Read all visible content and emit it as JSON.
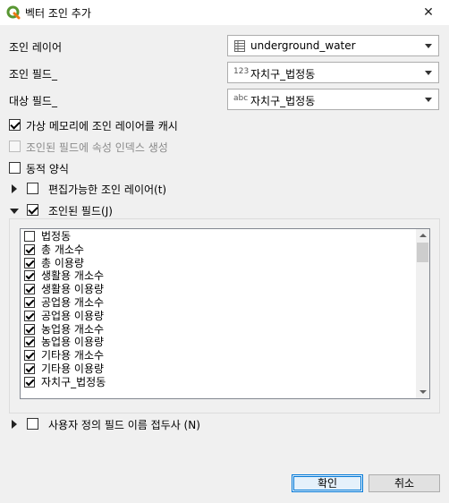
{
  "window": {
    "title": "벡터 조인 추가",
    "close_glyph": "✕"
  },
  "form": {
    "join_layer_label": "조인 레이어",
    "join_layer_value": "underground_water",
    "join_field_label": "조인 필드_",
    "join_field_type": "123",
    "join_field_value": "자치구_법정동",
    "target_field_label": "대상 필드_",
    "target_field_type": "abc",
    "target_field_value": "자치구_법정동"
  },
  "options": {
    "cache_label": "가상 메모리에 조인 레이어를 캐시",
    "cache_checked": true,
    "index_label": "조인된 필드에 속성 인덱스 생성",
    "index_checked": false,
    "dynamic_label": "동적 양식",
    "dynamic_checked": false,
    "editable_label": "편집가능한 조인 레이어(t)",
    "editable_checked": false,
    "joined_fields_label": "조인된 필드(J)",
    "joined_fields_checked": true,
    "prefix_label": "사용자 정의 필드 이름 접두사 (N)",
    "prefix_checked": false
  },
  "fields": [
    {
      "name": "법정동",
      "checked": false
    },
    {
      "name": "총 개소수",
      "checked": true
    },
    {
      "name": "총 이용량",
      "checked": true
    },
    {
      "name": "생활용 개소수",
      "checked": true
    },
    {
      "name": "생활용 이용량",
      "checked": true
    },
    {
      "name": "공업용 개소수",
      "checked": true
    },
    {
      "name": "공업용 이용량",
      "checked": true
    },
    {
      "name": "농업용 개소수",
      "checked": true
    },
    {
      "name": "농업용 이용량",
      "checked": true
    },
    {
      "name": "기타용 개소수",
      "checked": true
    },
    {
      "name": "기타용 이용량",
      "checked": true
    },
    {
      "name": "자치구_법정동",
      "checked": true
    }
  ],
  "buttons": {
    "ok": "확인",
    "cancel": "취소"
  },
  "colors": {
    "accent": "#0078d7",
    "qgis_green": "#589632",
    "qgis_yellow": "#ee7913"
  }
}
